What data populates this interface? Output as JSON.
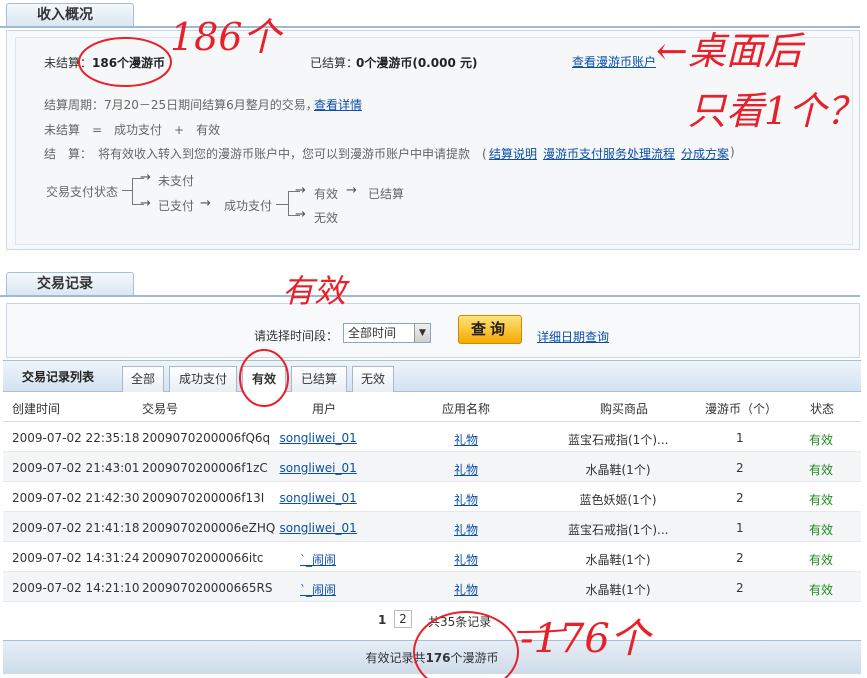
{
  "income_section": {
    "tab_label": "收入概况",
    "unsettled_label": "未结算：",
    "unsettled_value": "186个漫游币",
    "settled_label": "已结算：",
    "settled_value": "0个漫游币(0.000 元)",
    "view_account_link": "查看漫游币账户",
    "cycle_text": "结算周期：7月20－25日期间结算6月整月的交易，",
    "cycle_link": "查看详情",
    "formula_text": "未结算　=　成功支付　+　有效",
    "settle_text": "结　算：　将有效收入转入到您的漫游币账户中，您可以到漫游币账户中申请提款　(",
    "settle_links": [
      "结算说明",
      "漫游币支付服务处理流程",
      "分成方案"
    ],
    "settle_close": ")",
    "flow": {
      "label": "交易支付状态",
      "unpaid": "未支付",
      "paid": "已支付",
      "success": "成功支付",
      "valid": "有效",
      "settled": "已结算",
      "invalid": "无效"
    }
  },
  "records_section": {
    "tab_label": "交易记录",
    "period_label": "请选择时间段：",
    "period_selected": "全部时间",
    "query_button": "查询",
    "detail_link": "详细日期查询"
  },
  "list": {
    "title": "交易记录列表",
    "tabs": [
      "全部",
      "成功支付",
      "有效",
      "已结算",
      "无效"
    ],
    "active_tab": "有效",
    "columns": [
      "创建时间",
      "交易号",
      "用户",
      "应用名称",
      "购买商品",
      "漫游币（个）",
      "状态"
    ],
    "rows": [
      {
        "time": "2009-07-02 22:35:18",
        "id": "2009070200006fQ6q",
        "user": "songliwei_01",
        "app": "礼物",
        "item": "蓝宝石戒指(1个)...",
        "coins": "1",
        "status": "有效"
      },
      {
        "time": "2009-07-02 21:43:01",
        "id": "2009070200006f1zC",
        "user": "songliwei_01",
        "app": "礼物",
        "item": "水晶鞋(1个)",
        "coins": "2",
        "status": "有效"
      },
      {
        "time": "2009-07-02 21:42:30",
        "id": "2009070200006f13I",
        "user": "songliwei_01",
        "app": "礼物",
        "item": "蓝色妖姬(1个)",
        "coins": "2",
        "status": "有效"
      },
      {
        "time": "2009-07-02 21:41:18",
        "id": "2009070200006eZHQ",
        "user": "songliwei_01",
        "app": "礼物",
        "item": "蓝宝石戒指(1个)...",
        "coins": "1",
        "status": "有效"
      },
      {
        "time": "2009-07-02 14:31:24",
        "id": "20090702000066itc",
        "user": "`_闹闹",
        "app": "礼物",
        "item": "水晶鞋(1个)",
        "coins": "2",
        "status": "有效"
      },
      {
        "time": "2009-07-02 14:21:10",
        "id": "200907020000665RS",
        "user": "`_闹闹",
        "app": "礼物",
        "item": "水晶鞋(1个)",
        "coins": "2",
        "status": "有效"
      }
    ],
    "pager": {
      "current": "1",
      "next": "2",
      "total_text": "共35条记录"
    },
    "footer_prefix": "有效记录共",
    "footer_count": "176",
    "footer_suffix": "个漫游币"
  },
  "annotations": {
    "note_186": "186个",
    "note_desktop": "←桌面后",
    "note_only_one": "只看1个？",
    "note_valid": "有效",
    "note_176": "-176个",
    "ink_color": "#e8202a"
  }
}
